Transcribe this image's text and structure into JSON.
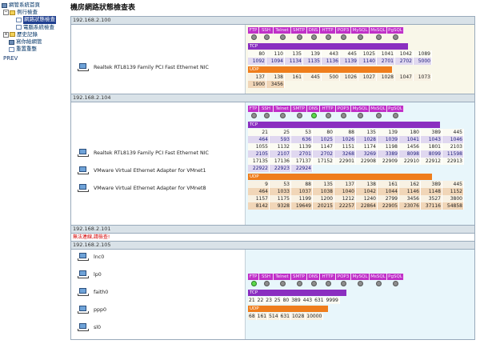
{
  "tree": {
    "root": "網管系統首頁",
    "folder_running": "例行檢查",
    "item_port_check": "網路狀態檢查",
    "item_computer_check": "電腦系統檢查",
    "folder_history": "歷史記錄",
    "item_write_log": "寫你給網管",
    "item_reset": "重置重整",
    "prev": "PREV"
  },
  "title": "機房網路狀態檢查表",
  "services": [
    "FTP",
    "SSH",
    "Telnet",
    "SMTP",
    "DNS",
    "HTTP",
    "POP3",
    "MySQL",
    "MsSQL",
    "PgSQL"
  ],
  "tcp_label": "TCP",
  "udp_label": "UDP",
  "hosts": [
    {
      "ip": "192.168.2.100",
      "nics": [
        "Realtek RTL8139 Family PCI Fast Ethernet NIC"
      ],
      "status": [
        "off",
        "off",
        "off",
        "off",
        "off",
        "off",
        "off",
        "off",
        "off",
        "off"
      ],
      "tcp": [
        [
          "80",
          "110",
          "135",
          "139",
          "443",
          "445",
          "1025",
          "1041",
          "1042",
          "1089"
        ],
        [
          "1092",
          "1094",
          "1134",
          "1135",
          "1136",
          "1139",
          "1140",
          "2701",
          "2702",
          "5000"
        ]
      ],
      "udp": [
        [
          "137",
          "138",
          "161",
          "445",
          "500",
          "1026",
          "1027",
          "1028",
          "1047",
          "1073"
        ],
        [
          "1900",
          "3456"
        ]
      ]
    },
    {
      "ip": "192.168.2.104",
      "nics": [
        "Realtek RTL8139 Family PCI Fast Ethernet NIC",
        "VMware Virtual Ethernet Adapter for VMnet1",
        "VMware Virtual Ethernet Adapter for VMnet8"
      ],
      "status": [
        "off",
        "off",
        "off",
        "off",
        "on",
        "off",
        "off",
        "off",
        "off",
        "off"
      ],
      "tcp": [
        [
          "21",
          "25",
          "53",
          "80",
          "88",
          "135",
          "139",
          "180",
          "389",
          "445"
        ],
        [
          "464",
          "593",
          "636",
          "1025",
          "1026",
          "1028",
          "1039",
          "1041",
          "1043",
          "1046"
        ],
        [
          "1055",
          "1132",
          "1139",
          "1147",
          "1151",
          "1174",
          "1198",
          "1456",
          "1801",
          "2103"
        ],
        [
          "2105",
          "2107",
          "2701",
          "2702",
          "3268",
          "3269",
          "3389",
          "8098",
          "8099",
          "11598"
        ],
        [
          "17135",
          "17136",
          "17137",
          "17152",
          "22901",
          "22908",
          "22909",
          "22910",
          "22912",
          "22913"
        ],
        [
          "22922",
          "22923",
          "22924"
        ]
      ],
      "udp": [
        [
          "9",
          "53",
          "88",
          "135",
          "137",
          "138",
          "161",
          "162",
          "389",
          "445"
        ],
        [
          "464",
          "1033",
          "1037",
          "1038",
          "1040",
          "1042",
          "1044",
          "1146",
          "1148",
          "1152"
        ],
        [
          "1157",
          "1175",
          "1199",
          "1200",
          "1212",
          "1240",
          "2799",
          "3456",
          "3527",
          "3800"
        ],
        [
          "8142",
          "9328",
          "19649",
          "20215",
          "22257",
          "22864",
          "22905",
          "23076",
          "37116",
          "54858"
        ]
      ]
    },
    {
      "ip": "192.168.2.101",
      "error": "無法連線,請檢查!"
    },
    {
      "ip": "192.168.2.105",
      "nics": [
        "lnc0",
        "lp0",
        "faith0",
        "ppp0",
        "sl0"
      ],
      "status": [
        "on",
        "off",
        "off",
        "off",
        "off",
        "off",
        "off",
        "off",
        "off",
        "off"
      ],
      "tcp": [
        [
          "21",
          "22",
          "23",
          "25",
          "80",
          "389",
          "443",
          "631",
          "9999"
        ]
      ],
      "udp": [
        [
          "68",
          "161",
          "514",
          "631",
          "1028",
          "10000"
        ]
      ]
    }
  ]
}
